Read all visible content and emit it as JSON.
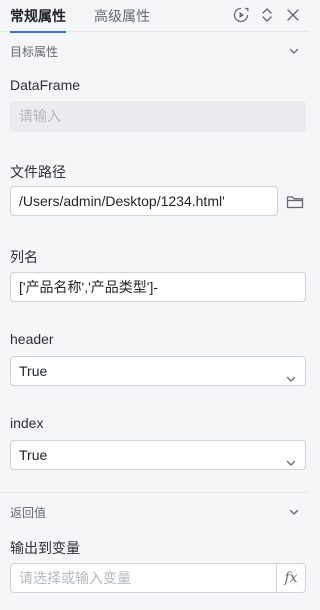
{
  "tabs": [
    {
      "label": "常规属性",
      "active": true
    },
    {
      "label": "高级属性",
      "active": false
    }
  ],
  "header_icons": [
    "run-icon",
    "collapse-expand-icon",
    "close-icon"
  ],
  "target_section": {
    "title": "目标属性",
    "fields": {
      "dataframe": {
        "label": "DataFrame",
        "placeholder": "请输入",
        "value": ""
      },
      "file_path": {
        "label": "文件路径",
        "value": "/Users/admin/Desktop/1234.html'"
      },
      "columns": {
        "label": "列名",
        "value": "['产品名称','产品类型']-"
      },
      "header": {
        "label": "header",
        "value": "True"
      },
      "index": {
        "label": "index",
        "value": "True"
      }
    }
  },
  "return_section": {
    "title": "返回值",
    "output_var": {
      "label": "输出到变量",
      "placeholder": "请选择或输入变量",
      "fx_label": "fx"
    }
  },
  "colors": {
    "accent": "#3370ff",
    "background": "#f5f6f8",
    "border": "#d0d3d9"
  }
}
